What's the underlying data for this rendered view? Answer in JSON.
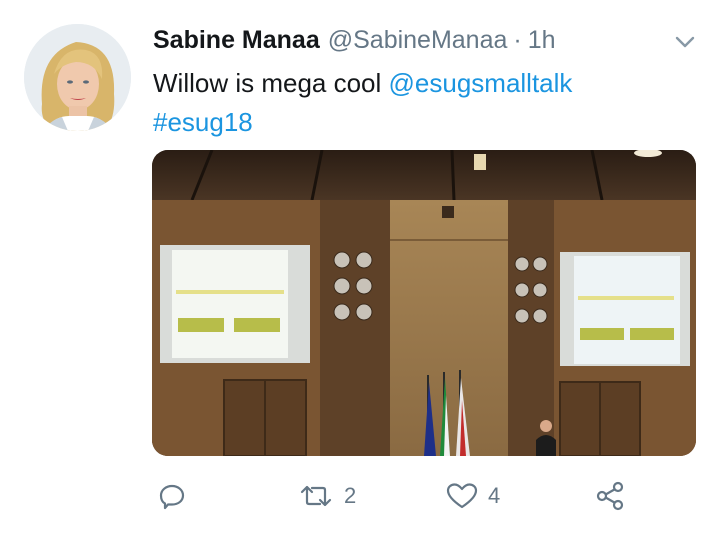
{
  "tweet": {
    "display_name": "Sabine Manaa",
    "handle": "@SabineManaa",
    "separator": "·",
    "time": "1h",
    "text_plain": "Willow is mega cool ",
    "mention": "@esugsmalltalk",
    "hashtag": "#esug18"
  },
  "actions": {
    "reply_count": "",
    "retweet_count": "2",
    "like_count": "4"
  },
  "colors": {
    "link": "#1b95e0",
    "secondary_text": "#657786",
    "primary_text": "#14171a"
  },
  "icons": [
    "chevron-down-icon",
    "reply-icon",
    "retweet-icon",
    "like-icon",
    "share-icon"
  ]
}
